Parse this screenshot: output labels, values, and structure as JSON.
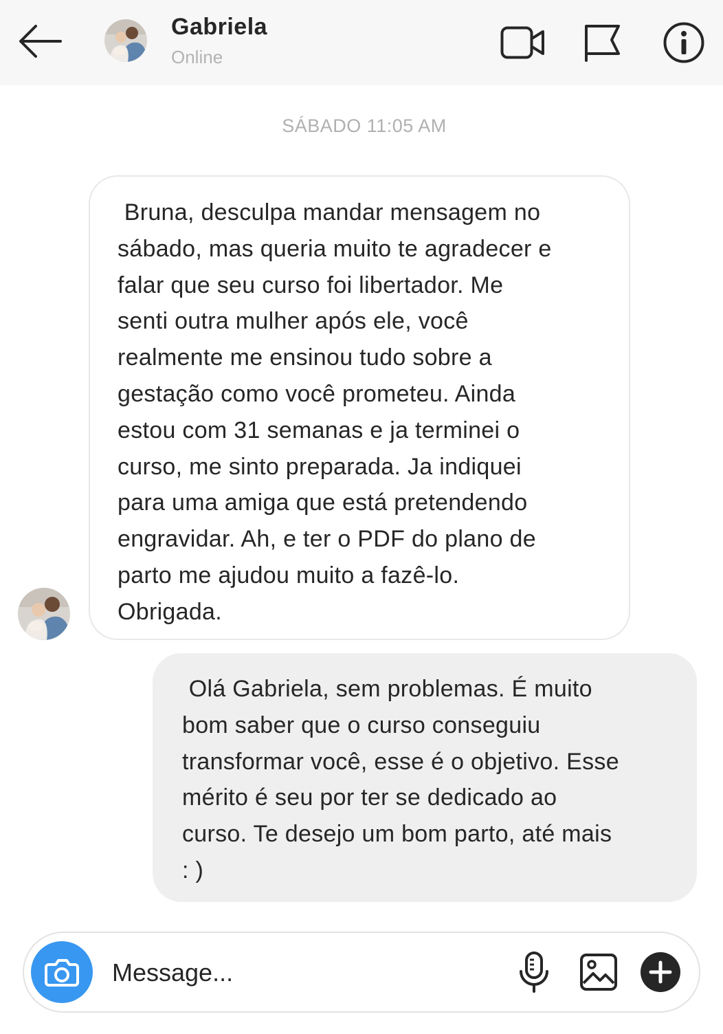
{
  "header": {
    "contact_name": "Gabriela",
    "status": "Online",
    "icons": [
      "back-arrow-icon",
      "video-call-icon",
      "flag-icon",
      "info-icon"
    ]
  },
  "conversation": {
    "timestamp": "SÁBADO 11:05 AM",
    "messages": [
      {
        "direction": "incoming",
        "text": " Bruna, desculpa mandar mensagem no\nsábado, mas queria muito te agradecer e\nfalar que seu curso foi libertador. Me\nsenti outra mulher após ele, você\nrealmente me ensinou tudo sobre a\ngestação como você prometeu. Ainda\nestou com 31 semanas e ja terminei o\ncurso, me sinto preparada. Ja indiquei\npara uma amiga que está pretendendo\nengravidar. Ah, e ter o PDF do plano de\nparto me ajudou muito a fazê-lo.\nObrigada."
      },
      {
        "direction": "outgoing",
        "text": " Olá Gabriela, sem problemas. É muito\nbom saber que o curso conseguiu\ntransformar você, esse é o objetivo. Esse\nmérito é seu por ter se dedicado ao\ncurso. Te desejo um bom parto, até mais\n: )"
      }
    ]
  },
  "composer": {
    "placeholder": "Message...",
    "value": "",
    "icons": [
      "camera-icon",
      "microphone-icon",
      "image-icon",
      "plus-icon"
    ]
  },
  "colors": {
    "header_bg": "#f7f7f7",
    "camera_button": "#3897f0",
    "outgoing_bubble": "#efefef",
    "timestamp_text": "#b0b0b0"
  }
}
